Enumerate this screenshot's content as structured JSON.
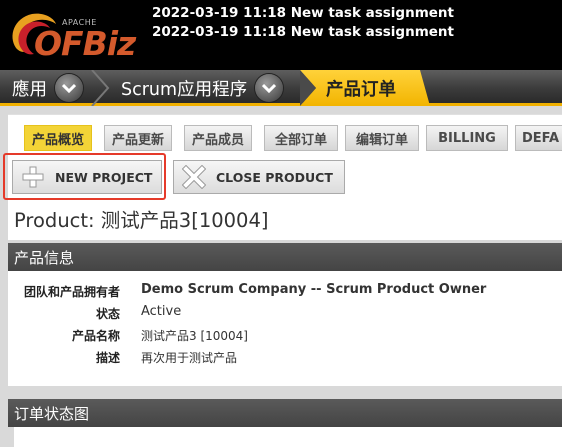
{
  "header": {
    "logo_small": "APACHE",
    "logo_text": "OFBiz",
    "alerts": [
      "2022-03-19 11:18 New task assignment",
      "2022-03-19 11:18 New task assignment"
    ]
  },
  "app_tabs": [
    {
      "label": "應用"
    },
    {
      "label": "Scrum应用程序"
    },
    {
      "label": "产品订单",
      "active": true
    }
  ],
  "sub_tabs": [
    {
      "label": "产品概览",
      "active": true
    },
    {
      "label": "产品更新"
    },
    {
      "label": "产品成员"
    },
    {
      "label": "全部订单"
    },
    {
      "label": "编辑订单"
    },
    {
      "label": "BILLING"
    },
    {
      "label": "DEFA"
    }
  ],
  "buttons": {
    "new_project": "NEW PROJECT",
    "close_product": "CLOSE PRODUCT"
  },
  "page_title": "Product: 测试产品3[10004]",
  "product_info": {
    "heading": "产品信息",
    "rows": [
      {
        "label": "团队和产品拥有者",
        "value": "Demo Scrum Company -- Scrum Product Owner"
      },
      {
        "label": "状态",
        "value": "Active"
      },
      {
        "label": "产品名称",
        "value": "测试产品3 [10004]"
      },
      {
        "label": "描述",
        "value": "再次用于测试产品"
      }
    ]
  },
  "order_status": {
    "heading": "订单状态图"
  },
  "colors": {
    "accent": "#f0b000",
    "active_subtab": "#f3d437",
    "logo": "#d45a2c",
    "highlight": "#e53a2a"
  }
}
